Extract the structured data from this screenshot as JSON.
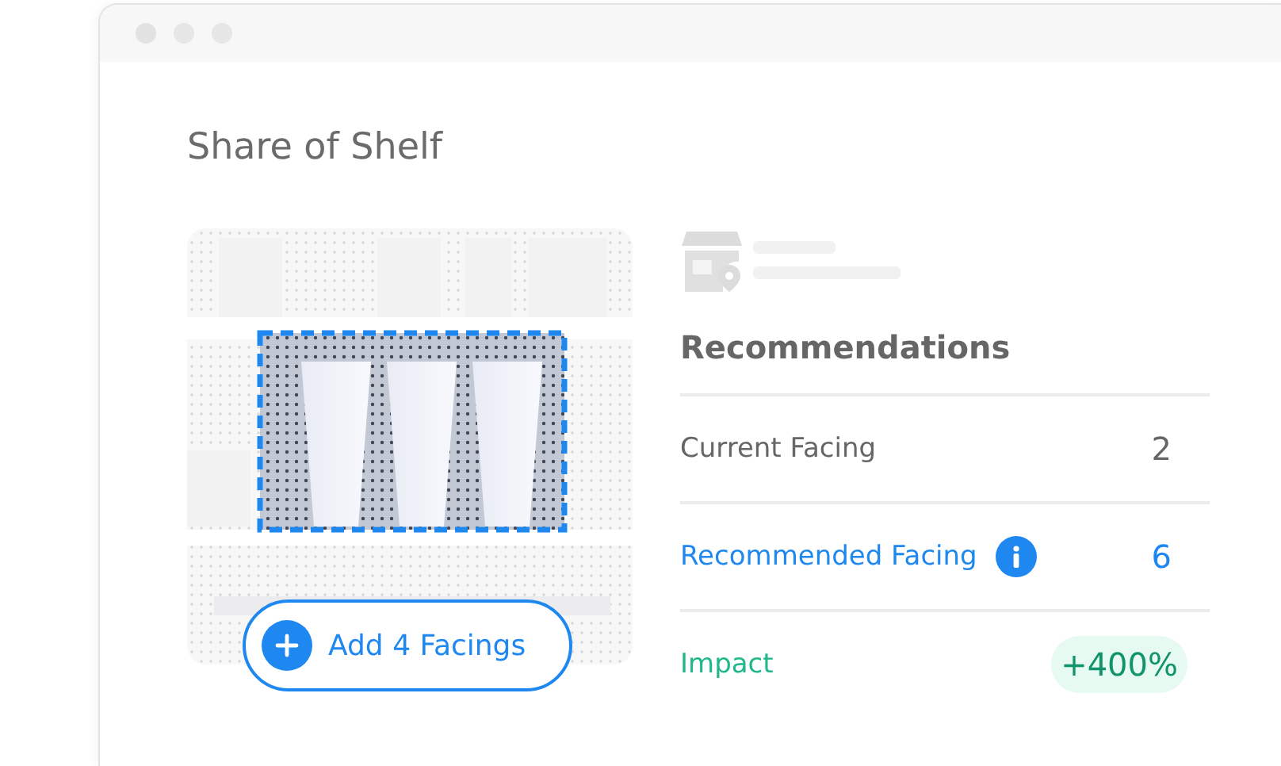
{
  "window": {
    "title": "Share of Shelf"
  },
  "shelf": {
    "button_label": "Add 4 Facings"
  },
  "recommendations": {
    "heading": "Recommendations",
    "rows": [
      {
        "kind": "current",
        "label": "Current Facing",
        "value": "2"
      },
      {
        "kind": "recommended",
        "label": "Recommended Facing",
        "value": "6"
      },
      {
        "kind": "impact",
        "label": "Impact",
        "value": "+400%"
      }
    ]
  }
}
